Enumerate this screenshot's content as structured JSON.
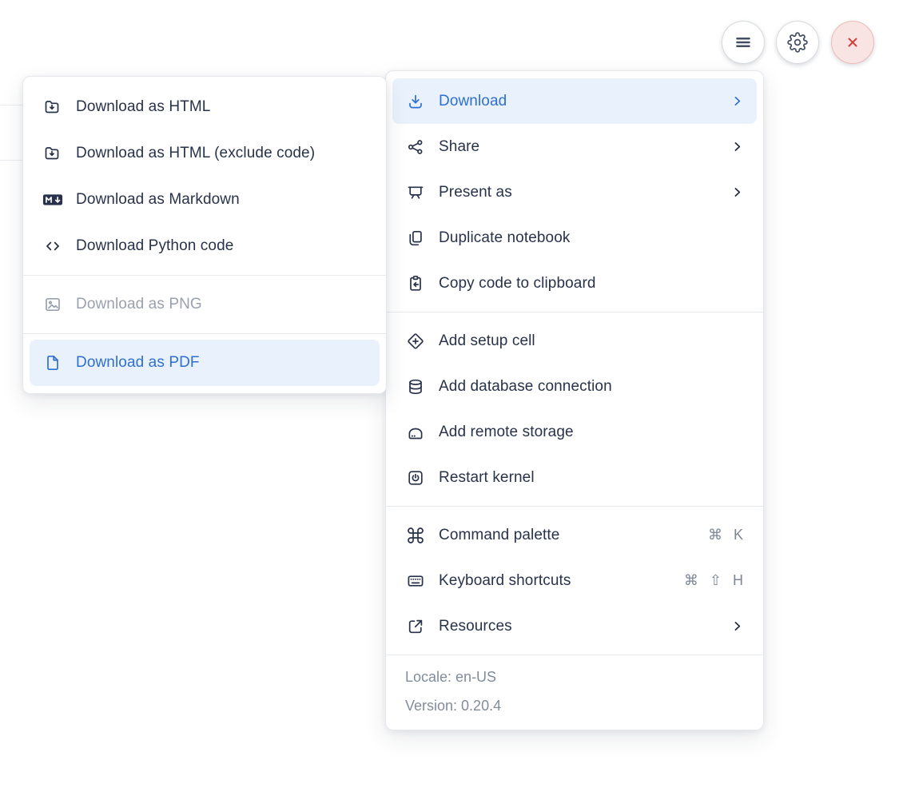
{
  "toolbar": {
    "buttons": [
      {
        "name": "menu",
        "icon": "hamburger-icon"
      },
      {
        "name": "settings",
        "icon": "gear-icon"
      },
      {
        "name": "close",
        "icon": "close-icon"
      }
    ]
  },
  "download_submenu": {
    "items": [
      {
        "label": "Download as HTML",
        "icon": "folder-download-icon",
        "state": "normal"
      },
      {
        "label": "Download as HTML (exclude code)",
        "icon": "folder-download-icon",
        "state": "normal"
      },
      {
        "label": "Download as Markdown",
        "icon": "markdown-icon",
        "state": "normal"
      },
      {
        "label": "Download Python code",
        "icon": "code-icon",
        "state": "normal"
      },
      {
        "label": "Download as PNG",
        "icon": "image-icon",
        "state": "disabled"
      },
      {
        "label": "Download as PDF",
        "icon": "file-icon",
        "state": "highlighted"
      }
    ]
  },
  "main_menu": {
    "items": [
      {
        "label": "Download",
        "icon": "download-icon",
        "has_submenu": true,
        "state": "highlighted"
      },
      {
        "label": "Share",
        "icon": "share-icon",
        "has_submenu": true
      },
      {
        "label": "Present as",
        "icon": "presentation-icon",
        "has_submenu": true
      },
      {
        "label": "Duplicate notebook",
        "icon": "duplicate-icon"
      },
      {
        "label": "Copy code to clipboard",
        "icon": "clipboard-icon"
      },
      {
        "label": "Add setup cell",
        "icon": "plus-diamond-icon"
      },
      {
        "label": "Add database connection",
        "icon": "database-icon"
      },
      {
        "label": "Add remote storage",
        "icon": "storage-icon"
      },
      {
        "label": "Restart kernel",
        "icon": "power-icon"
      },
      {
        "label": "Command palette",
        "icon": "command-icon",
        "shortcut": "⌘ K"
      },
      {
        "label": "Keyboard shortcuts",
        "icon": "keyboard-icon",
        "shortcut": "⌘ ⇧ H"
      },
      {
        "label": "Resources",
        "icon": "external-link-icon",
        "has_submenu": true
      }
    ],
    "footer": {
      "locale": "Locale: en-US",
      "version": "Version: 0.20.4"
    }
  },
  "colors": {
    "accent_blue": "#2e70cf",
    "highlight_bg": "#e9f1fc",
    "text": "#28324a",
    "disabled_text": "#9aa1ae",
    "muted_text": "#828c9b",
    "danger_red": "#cf4040",
    "close_button_bg": "#f8e4e3"
  }
}
